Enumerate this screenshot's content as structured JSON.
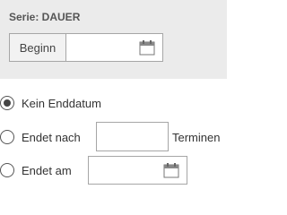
{
  "series": {
    "title": "Serie: DAUER",
    "start_label": "Beginn",
    "start_value": ""
  },
  "end_options": {
    "no_end_label": "Kein Enddatum",
    "after_label": "Endet nach",
    "after_count_value": "",
    "after_unit": "Terminen",
    "on_label": "Endet am",
    "on_date_value": "",
    "selected": "no_end"
  },
  "icons": {
    "calendar": "calendar-icon"
  }
}
